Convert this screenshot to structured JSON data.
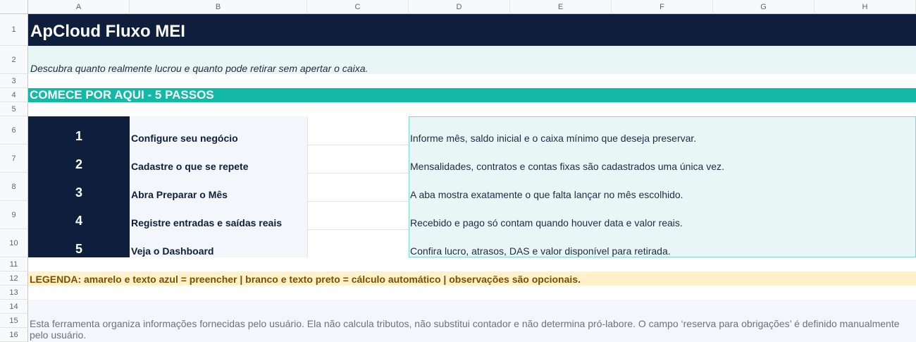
{
  "columns": [
    "A",
    "B",
    "C",
    "D",
    "E",
    "F",
    "G",
    "H"
  ],
  "rows": [
    "1",
    "2",
    "3",
    "4",
    "5",
    "6",
    "7",
    "8",
    "9",
    "10",
    "11",
    "12",
    "13",
    "14",
    "15",
    "16"
  ],
  "title": "ApCloud Fluxo MEI",
  "subtitle": "Descubra quanto realmente lucrou e quanto pode retirar sem apertar o caixa.",
  "section_header": "COMECE POR AQUI - 5 PASSOS",
  "steps": [
    {
      "number": "1",
      "title": "Configure seu negócio",
      "description": "Informe mês, saldo inicial e o caixa mínimo que deseja preservar."
    },
    {
      "number": "2",
      "title": "Cadastre o que se repete",
      "description": "Mensalidades, contratos e contas fixas são cadastrados uma única vez."
    },
    {
      "number": "3",
      "title": "Abra Preparar o Mês",
      "description": "A aba mostra exatamente o que falta lançar no mês escolhido."
    },
    {
      "number": "4",
      "title": "Registre entradas e saídas reais",
      "description": "Recebido e pago só contam quando houver data e valor reais."
    },
    {
      "number": "5",
      "title": "Veja o Dashboard",
      "description": "Confira lucro, atrasos, DAS e valor disponível para retirada."
    }
  ],
  "legend": "LEGENDA: amarelo e texto azul = preencher | branco e texto preto = cálculo automático | observações são opcionais.",
  "disclaimer": "Esta ferramenta organiza informações fornecidas pelo usuário. Ela não calcula tributos, não substitui contador e não determina pró-labore. O campo ‘reserva para obrigações’ é definido manualmente pelo usuário.",
  "colors": {
    "navy": "#0d1f3c",
    "teal": "#14b8a6",
    "light_teal": "#e8f6f5",
    "legend_yellow": "#fff1c9",
    "legend_text": "#7a4f00",
    "step_label_bg": "#f3f6fa"
  }
}
